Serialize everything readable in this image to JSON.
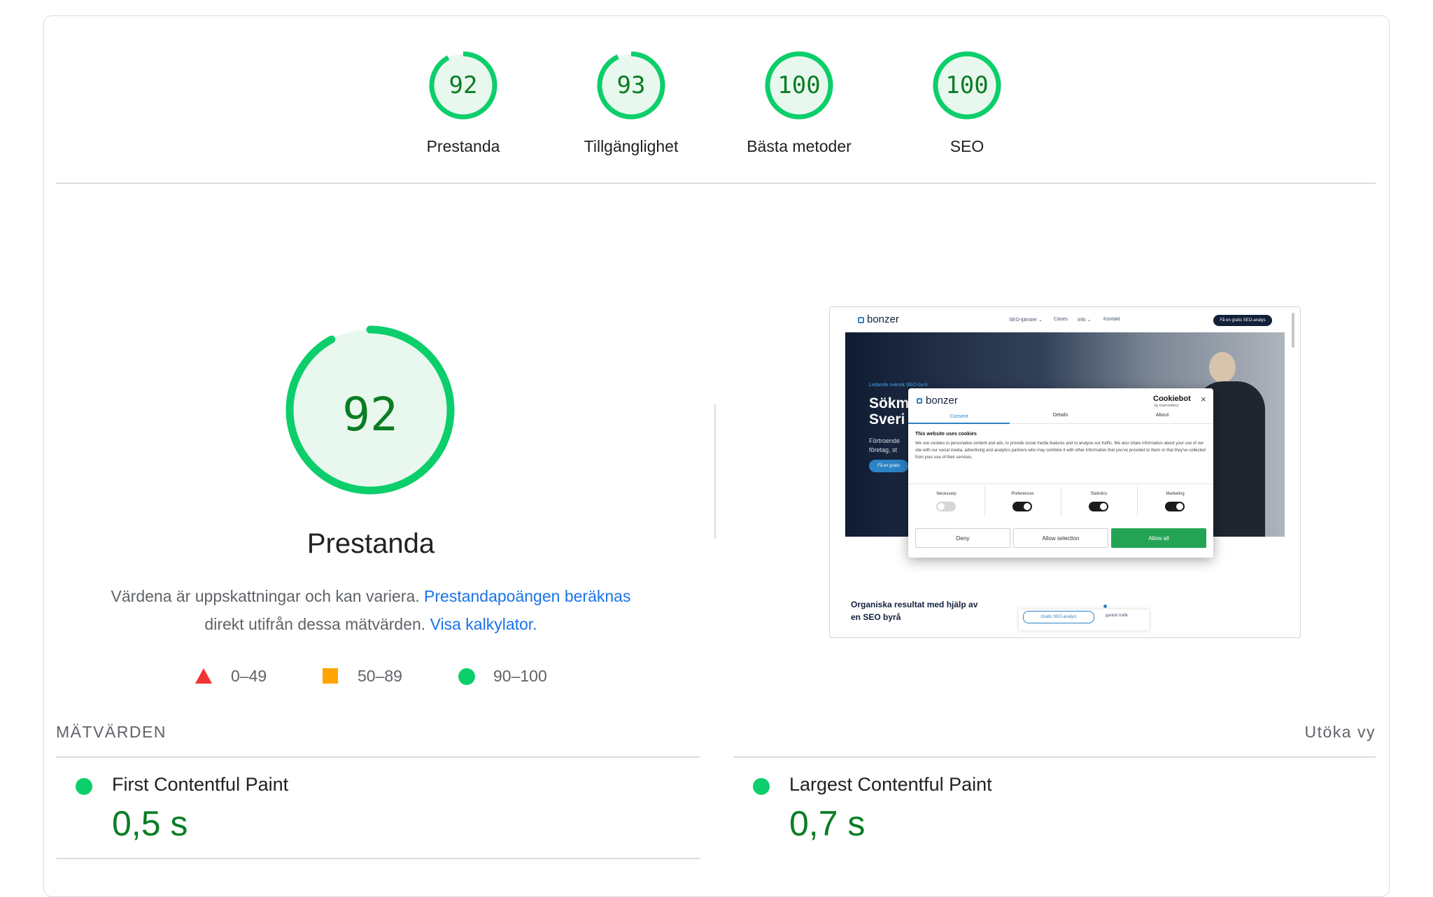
{
  "categories": [
    {
      "score": "92",
      "label": "Prestanda"
    },
    {
      "score": "93",
      "label": "Tillgänglighet"
    },
    {
      "score": "100",
      "label": "Bästa metoder"
    },
    {
      "score": "100",
      "label": "SEO"
    }
  ],
  "main_score": {
    "score": "92",
    "title": "Prestanda",
    "fraction": 0.92
  },
  "description": {
    "text1": "Värdena är uppskattningar och kan variera.",
    "link1": "Prestandapoängen beräknas",
    "text2": "direkt utifrån dessa mätvärden.",
    "link2": "Visa kalkylator."
  },
  "legend": [
    {
      "range": "0–49",
      "shape": "triangle",
      "color": "#f33333"
    },
    {
      "range": "50–89",
      "shape": "square",
      "color": "#ffa400"
    },
    {
      "range": "90–100",
      "shape": "circle",
      "color": "#0cce6b"
    }
  ],
  "metrics": {
    "header": "MÄTVÄRDEN",
    "expand": "Utöka vy",
    "items": [
      {
        "name": "First Contentful Paint",
        "value": "0,5 s"
      },
      {
        "name": "Largest Contentful Paint",
        "value": "0,7 s"
      }
    ]
  },
  "thumbnail": {
    "logo": "bonzer",
    "nav": [
      "SEO-tjänster ⌄",
      "Cases",
      "Info ⌄",
      "Kontakt"
    ],
    "cta": "Få en gratis SEO-analys",
    "hero_kicker": "Ledande svensk SEO-byrå",
    "hero_line1": "Sökm",
    "hero_line2": "Sveri",
    "hero_sub1": "Förtroende",
    "hero_sub2": "företag, st",
    "hero_btn": "Få en gratis",
    "bottom_heading1": "Organiska resultat med hjälp av",
    "bottom_heading2": "en SEO byrå",
    "bottom_chip": "Gratis SEO-analys!",
    "bottom_text": "ganisk trafik",
    "modal": {
      "logo": "bonzer",
      "brand": "Cookiebot",
      "brand_sub": "by Usercentrics",
      "close": "×",
      "tabs": [
        "Consent",
        "Details",
        "About"
      ],
      "heading": "This website uses cookies",
      "body": "We use cookies to personalise content and ads, to provide social media features and to analyse our traffic. We also share information about your use of our site with our social media, advertising and analytics partners who may combine it with other information that you've provided to them or that they've collected from your use of their services.",
      "toggles": [
        "Necessary",
        "Preferences",
        "Statistics",
        "Marketing"
      ],
      "buttons": [
        "Deny",
        "Allow selection",
        "Allow all"
      ]
    }
  }
}
